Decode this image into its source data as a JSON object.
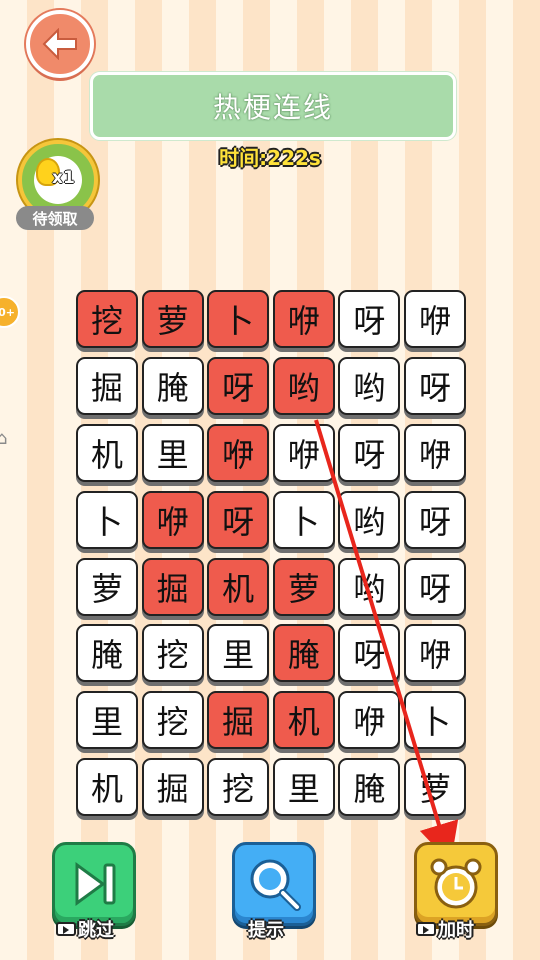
{
  "title": "热梗连线",
  "timer": "时间:222s",
  "bonus": {
    "multiplier": "x1",
    "tag": "待领取"
  },
  "edge_badge": "0+",
  "grid": [
    [
      "挖",
      "萝",
      "卜",
      "咿",
      "呀",
      "咿"
    ],
    [
      "掘",
      "腌",
      "呀",
      "哟",
      "哟",
      "呀"
    ],
    [
      "机",
      "里",
      "咿",
      "咿",
      "呀",
      "咿"
    ],
    [
      "卜",
      "咿",
      "呀",
      "卜",
      "哟",
      "呀"
    ],
    [
      "萝",
      "掘",
      "机",
      "萝",
      "哟",
      "呀"
    ],
    [
      "腌",
      "挖",
      "里",
      "腌",
      "呀",
      "咿"
    ],
    [
      "里",
      "挖",
      "掘",
      "机",
      "咿",
      "卜"
    ],
    [
      "机",
      "掘",
      "挖",
      "里",
      "腌",
      "萝"
    ]
  ],
  "selected": [
    [
      0,
      0
    ],
    [
      0,
      1
    ],
    [
      0,
      2
    ],
    [
      0,
      3
    ],
    [
      1,
      2
    ],
    [
      1,
      3
    ],
    [
      2,
      2
    ],
    [
      3,
      1
    ],
    [
      3,
      2
    ],
    [
      4,
      1
    ],
    [
      4,
      2
    ],
    [
      4,
      3
    ],
    [
      5,
      3
    ],
    [
      6,
      2
    ],
    [
      6,
      3
    ]
  ],
  "colors": {
    "selected": "#ef5b4d",
    "cell": "#ffffff",
    "arrow": "#e8261c"
  },
  "tools": {
    "skip_label": "跳过",
    "hint_label": "提示",
    "addtime_label": "加时"
  }
}
